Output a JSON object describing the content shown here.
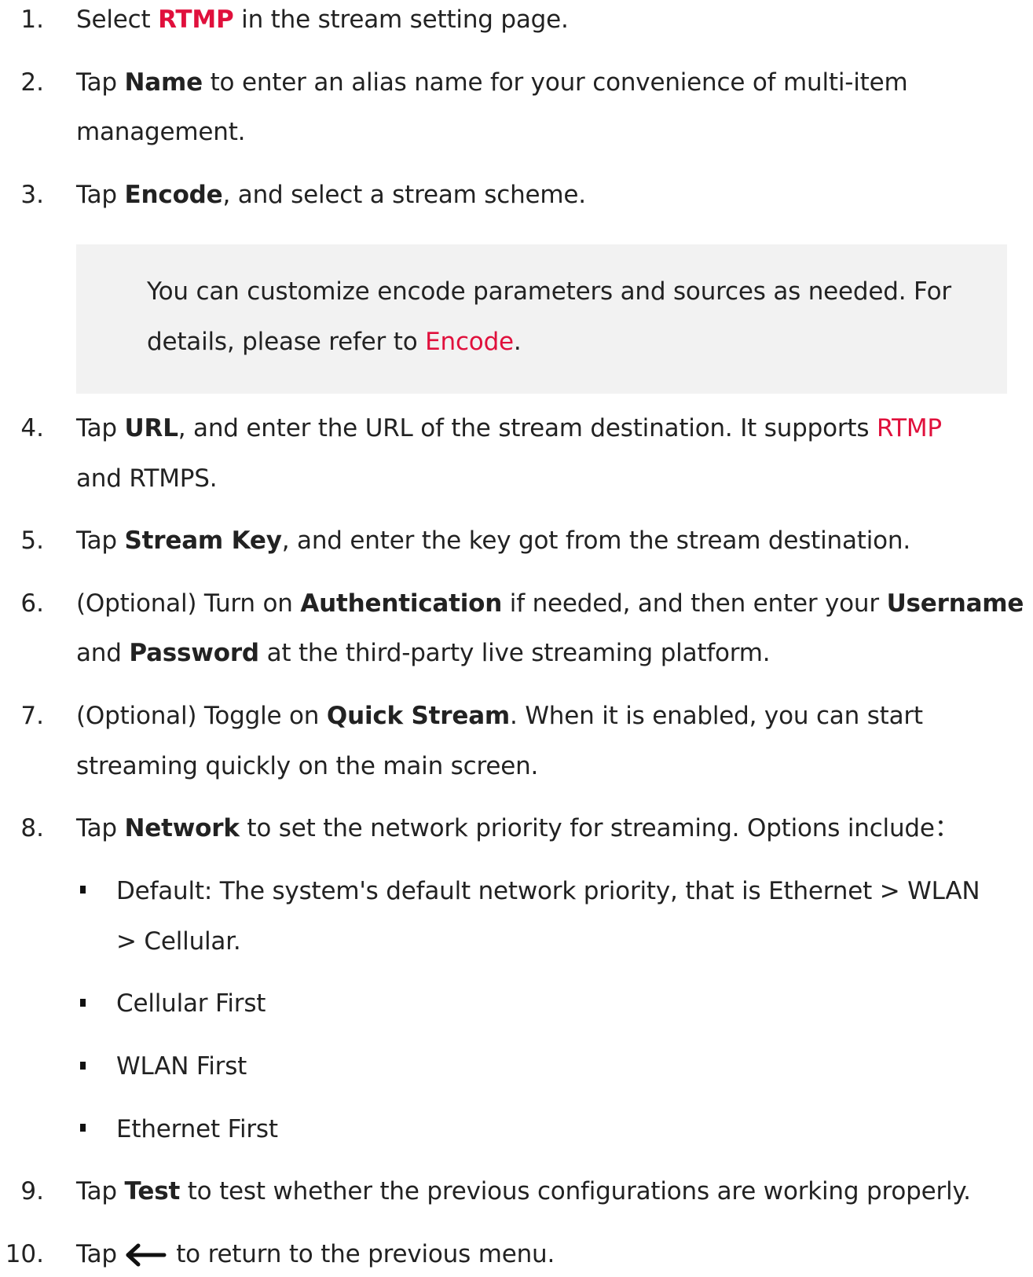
{
  "steps": {
    "s1": {
      "num": "1.",
      "pre": "Select ",
      "kw": "RTMP",
      "post": " in the stream setting page."
    },
    "s2": {
      "num": "2.",
      "pre": "Tap ",
      "kw": "Name",
      "post": " to enter an alias name for your convenience of multi-item",
      "cont": "management."
    },
    "s3": {
      "num": "3.",
      "pre": "Tap ",
      "kw": "Encode",
      "post": ", and select a stream scheme."
    },
    "note": {
      "line1": "You can customize encode parameters and sources as needed. For",
      "pre": "details, please refer to ",
      "link": "Encode",
      "post": "."
    },
    "s4": {
      "num": "4.",
      "pre": "Tap ",
      "kw": "URL",
      "post": ", and enter the URL of the stream destination. It supports ",
      "link": "RTMP",
      "cont": "and RTMPS."
    },
    "s5": {
      "num": "5.",
      "pre": "Tap ",
      "kw": "Stream Key",
      "post": ", and enter the key got from the stream destination."
    },
    "s6": {
      "num": "6.",
      "pre": "(Optional) Turn on ",
      "kw": "Authentication",
      "mid": " if needed, and then enter your ",
      "kw2": "Username",
      "cont_pre": "and ",
      "kw3": "Password",
      "cont_post": " at the third-party live streaming platform."
    },
    "s7": {
      "num": "7.",
      "pre": "(Optional) Toggle on ",
      "kw": "Quick Stream",
      "post": ". When it is enabled, you can start",
      "cont": "streaming quickly on the main screen."
    },
    "s8": {
      "num": "8.",
      "pre": "Tap ",
      "kw": "Network",
      "post": " to set the network priority for streaming. Options include："
    },
    "options": {
      "o1_line1": "Default: The system's default network priority, that is Ethernet > WLAN",
      "o1_line2": "> Cellular.",
      "o2": "Cellular First",
      "o3": "WLAN First",
      "o4": "Ethernet First"
    },
    "s9": {
      "num": "9.",
      "pre": "Tap ",
      "kw": "Test",
      "post": " to test whether the previous configurations are working properly."
    },
    "s10": {
      "num": "10.",
      "pre": "Tap ",
      "post": " to return to the previous menu.",
      "icon": "arrow-left-icon"
    }
  },
  "colors": {
    "accent": "#e0103c",
    "note_bg": "#f2f2f2"
  }
}
